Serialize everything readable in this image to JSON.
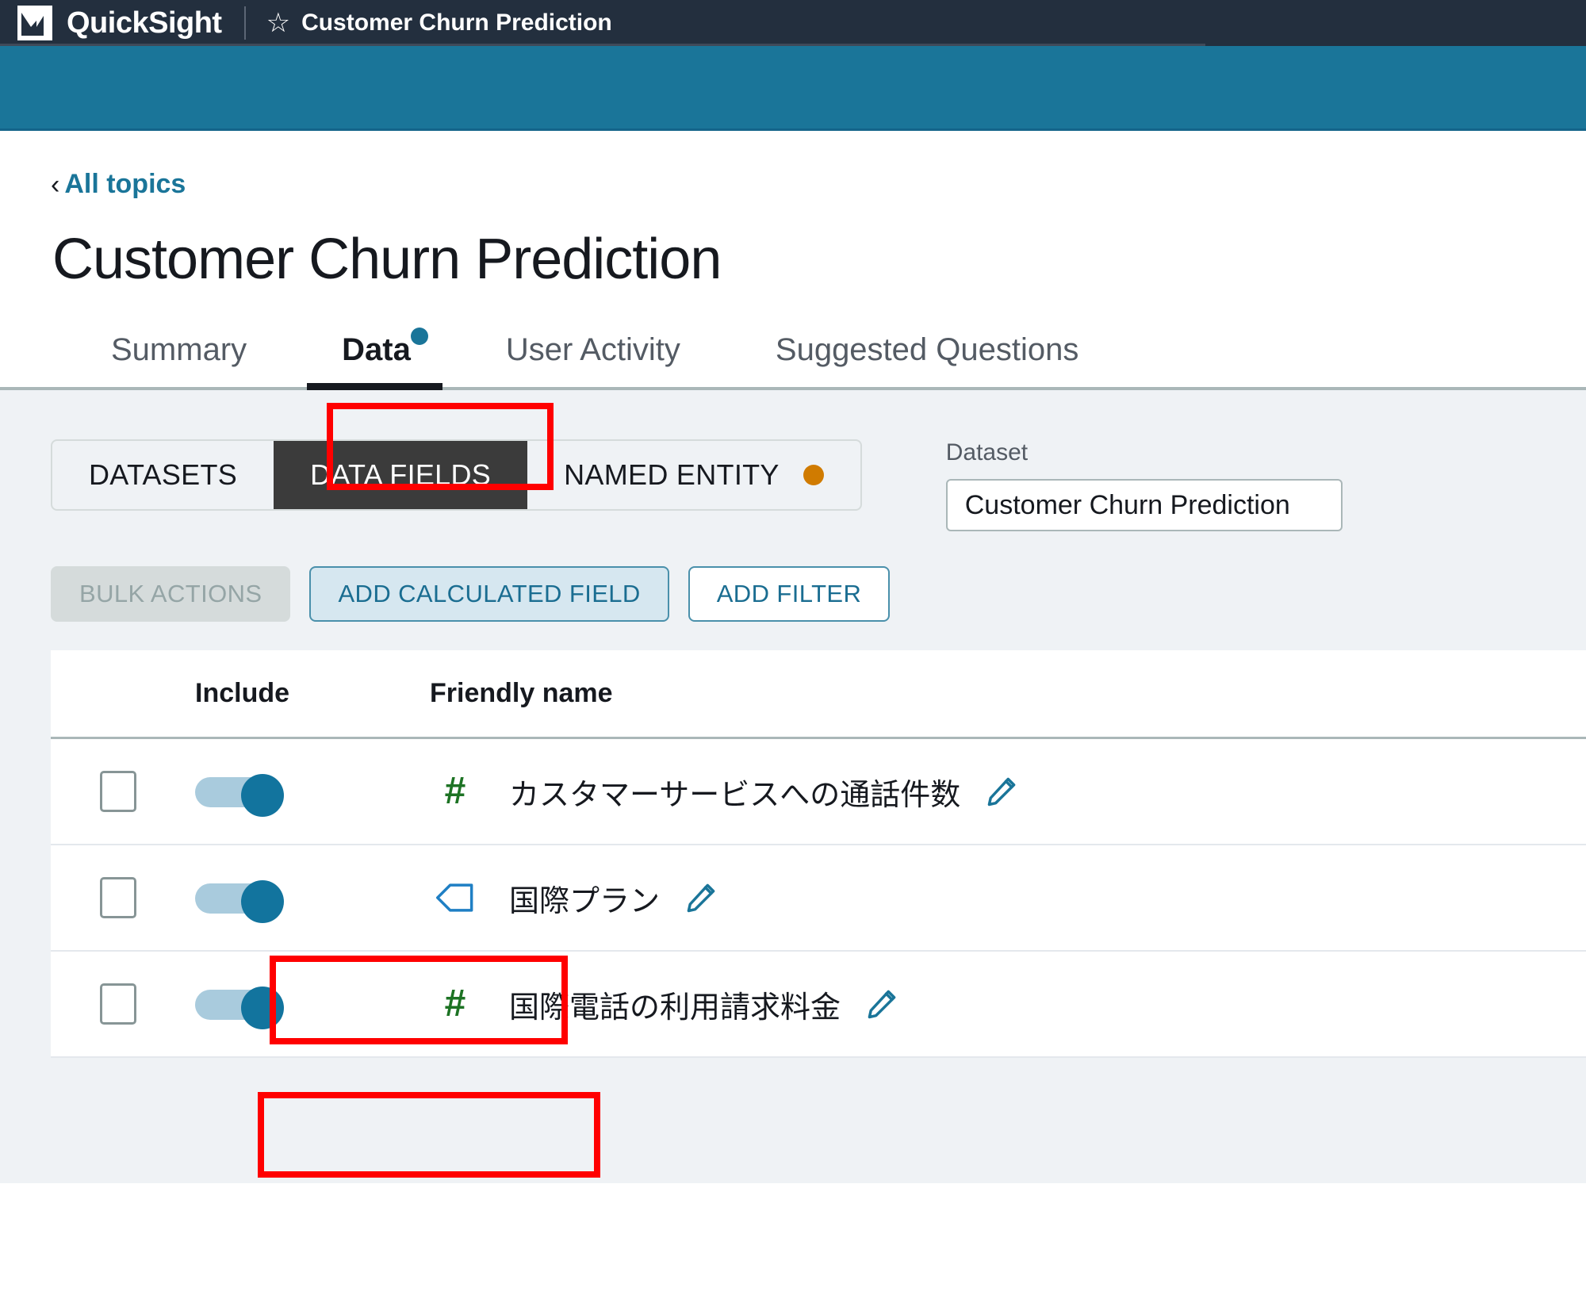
{
  "appbar": {
    "logo_icon": "quicksight-chart-logo",
    "product_name": "QuickSight",
    "star_icon": "star-outline-icon",
    "topic_title": "Customer Churn Prediction"
  },
  "page": {
    "breadcrumb_chevron": "chevron-left-icon",
    "breadcrumb_label": "All topics",
    "title": "Customer Churn Prediction"
  },
  "tabs": [
    {
      "label": "Summary",
      "active": false,
      "has_dot": false
    },
    {
      "label": "Data",
      "active": true,
      "has_dot": true
    },
    {
      "label": "User Activity",
      "active": false,
      "has_dot": false
    },
    {
      "label": "Suggested Questions",
      "active": false,
      "has_dot": false
    }
  ],
  "segmented": [
    {
      "label": "DATASETS",
      "active": false,
      "badge": false
    },
    {
      "label": "DATA FIELDS",
      "active": true,
      "badge": false
    },
    {
      "label": "NAMED ENTITY",
      "active": false,
      "badge": true
    }
  ],
  "dataset": {
    "label": "Dataset",
    "value": "Customer Churn Prediction"
  },
  "actions": {
    "bulk_actions": "BULK ACTIONS",
    "add_calculated_field": "ADD CALCULATED FIELD",
    "add_filter": "ADD FILTER"
  },
  "table": {
    "headers": {
      "include": "Include",
      "friendly_name": "Friendly name"
    },
    "rows": [
      {
        "checked": false,
        "included": true,
        "type_icon": "hash-number-icon",
        "name": "カスタマーサービスへの通話件数",
        "edit_icon": "pencil-edit-icon"
      },
      {
        "checked": false,
        "included": true,
        "type_icon": "tag-dimension-icon",
        "name": "国際プラン",
        "edit_icon": "pencil-edit-icon"
      },
      {
        "checked": false,
        "included": true,
        "type_icon": "hash-number-icon",
        "name": "国際電話の利用請求料金",
        "edit_icon": "pencil-edit-icon"
      }
    ]
  },
  "colors": {
    "appbar_bg": "#232f3e",
    "banner_bg": "#1a7599",
    "accent_blue": "#1a7599",
    "badge_orange": "#d07b00",
    "number_icon_green": "#1d7324",
    "annotation_red": "#ff0000",
    "active_segment_bg": "#3b3b3b"
  },
  "annotations": [
    {
      "name": "data-tab-highlight",
      "target": "Data"
    },
    {
      "name": "data-fields-segment-highlight",
      "target": "DATA FIELDS"
    },
    {
      "name": "add-calculated-field-highlight",
      "target": "ADD CALCULATED FIELD"
    }
  ]
}
